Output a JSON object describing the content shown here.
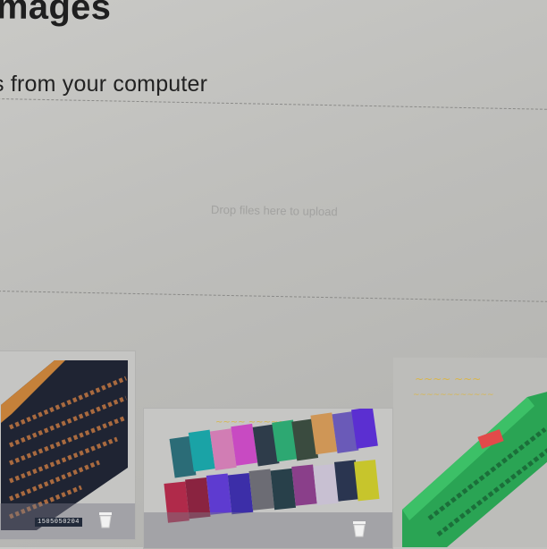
{
  "header": {
    "title": "mages",
    "subtitle": "s from your computer"
  },
  "dropzone": {
    "hint": "Drop files here to upload"
  },
  "gallery": {
    "items": [
      {
        "file_label": "1505050204",
        "remove_icon": "trash-icon"
      },
      {
        "file_label": "",
        "remove_icon": "trash-icon"
      },
      {
        "file_label": "",
        "remove_icon": "trash-icon"
      }
    ]
  },
  "colors": {
    "background": "#c4c4c1",
    "text": "#1f1f1f",
    "dashed_border": "#8a8a88",
    "hint_text": "#a2a2a0"
  }
}
